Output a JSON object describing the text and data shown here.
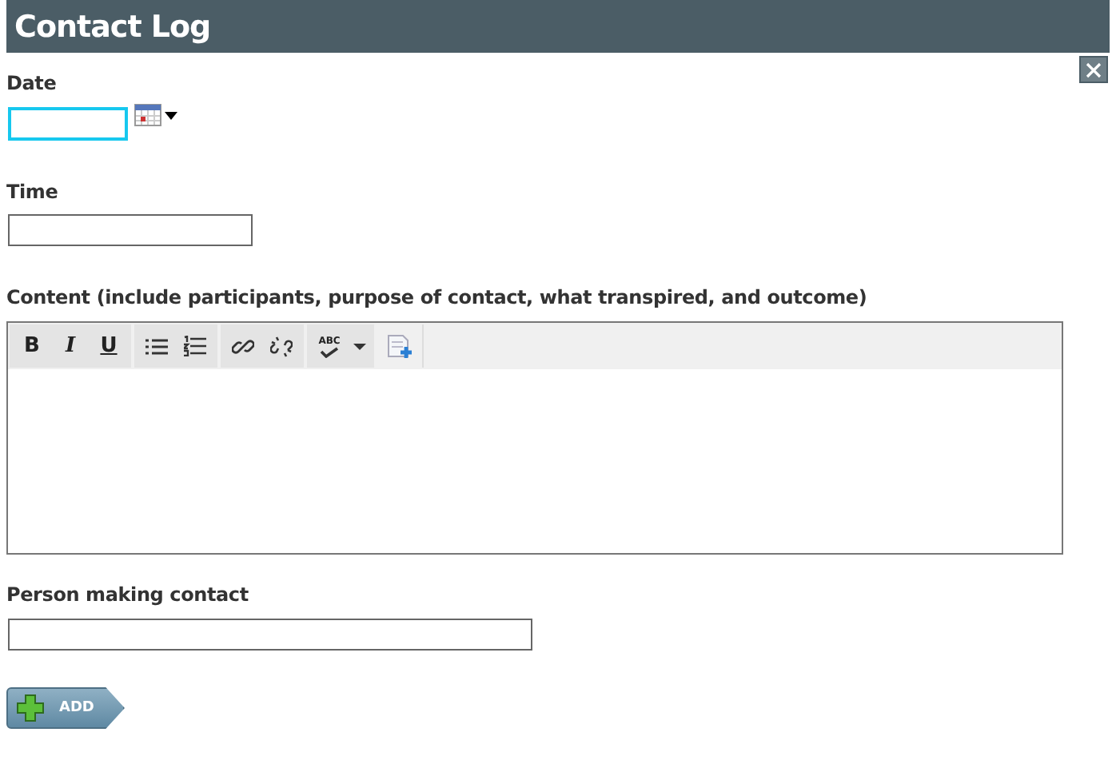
{
  "window": {
    "title": "Contact Log"
  },
  "fields": [
    {
      "kind": "date",
      "label": "Date",
      "focused": true
    },
    {
      "kind": "text",
      "label": "Time",
      "focused": false
    },
    {
      "kind": "editor",
      "label": "Content (include participants, purpose of contact, what transpired, and outcome)"
    },
    {
      "kind": "wide",
      "label": "Person making contact",
      "focused": false
    }
  ],
  "toolbar": [
    [
      {
        "kind": "bold",
        "label": "B"
      },
      {
        "kind": "italic",
        "label": "I"
      },
      {
        "kind": "underline",
        "label": "U"
      }
    ],
    [
      {
        "kind": "bullets"
      },
      {
        "kind": "numbers"
      }
    ],
    [
      {
        "kind": "link"
      },
      {
        "kind": "unlink"
      }
    ],
    [
      {
        "kind": "spell",
        "label": "ABC"
      },
      {
        "kind": "caret"
      }
    ],
    [
      {
        "kind": "insert"
      }
    ]
  ],
  "add_button": {
    "label": "ADD"
  }
}
